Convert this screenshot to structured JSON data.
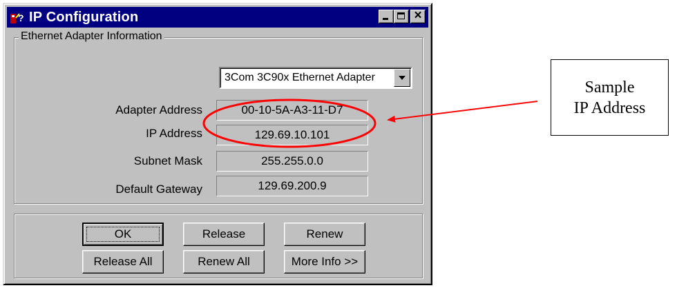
{
  "window": {
    "title": "IP Configuration"
  },
  "adapter_group": {
    "label": "Ethernet  Adapter Information",
    "adapter_selected": "3Com 3C90x Ethernet Adapter",
    "fields": [
      {
        "label": "Adapter Address",
        "value": "00-10-5A-A3-11-D7"
      },
      {
        "label": "IP Address",
        "value": "129.69.10.101"
      },
      {
        "label": "Subnet Mask",
        "value": "255.255.0.0"
      },
      {
        "label": "Default Gateway",
        "value": "129.69.200.9"
      }
    ]
  },
  "buttons": {
    "ok": "OK",
    "release": "Release",
    "renew": "Renew",
    "release_all": "Release All",
    "renew_all": "Renew All",
    "more_info": "More Info >>"
  },
  "annotation": {
    "callout_line1": "Sample",
    "callout_line2": "IP Address",
    "color": "#ff0000"
  },
  "colors": {
    "titlebar": "#000080",
    "face": "#c0c0c0"
  }
}
